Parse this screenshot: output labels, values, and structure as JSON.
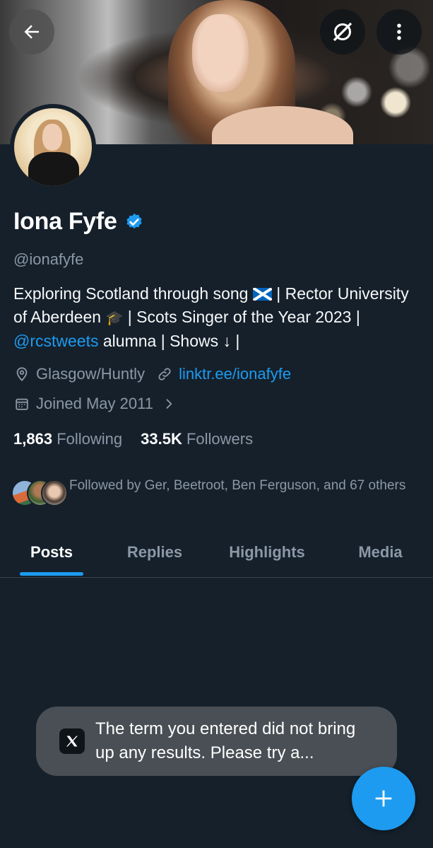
{
  "profile": {
    "name": "Iona Fyfe",
    "handle": "@ionafyfe",
    "bio": {
      "part1": "Exploring Scotland through song ",
      "part2": " | Rector University of Aberdeen ",
      "part3": " | Scots Singer of the Year 2023 | ",
      "mention": "@rcstweets",
      "part4": " alumna | Shows ↓ |"
    },
    "location": "Glasgow/Huntly",
    "website": "linktr.ee/ionafyfe",
    "joined": "Joined May 2011",
    "following_count": "1,863",
    "following_label": "Following",
    "followers_count": "33.5K",
    "followers_label": "Followers",
    "followed_by": "Followed by Ger, Beetroot, Ben Ferguson, and 67 others"
  },
  "tabs": [
    {
      "label": "Posts",
      "active": true
    },
    {
      "label": "Replies",
      "active": false
    },
    {
      "label": "Highlights",
      "active": false
    },
    {
      "label": "Media",
      "active": false
    }
  ],
  "toast": {
    "text": "The term you entered did not bring up any results. Please try a..."
  },
  "icons": {
    "back": "arrow-left-icon",
    "translate": "no-translate-icon",
    "more": "more-vertical-icon",
    "verified": "verified-badge-icon",
    "location": "location-pin-icon",
    "link": "link-icon",
    "calendar": "calendar-icon",
    "chevron": "chevron-right-icon",
    "x_logo": "x-logo-icon",
    "compose": "plus-icon"
  },
  "colors": {
    "background": "#15202b",
    "accent": "#1d9bf0",
    "secondary_text": "#8b98a5",
    "toast_bg": "#4a4f55"
  }
}
